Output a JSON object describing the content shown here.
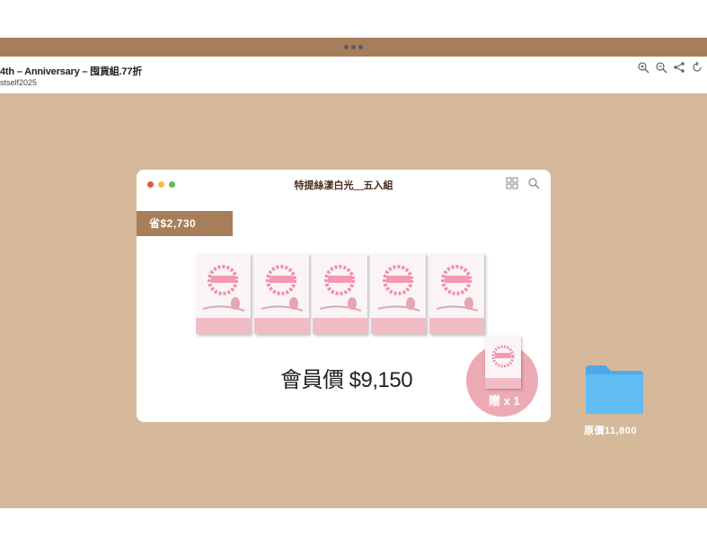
{
  "viewer": {
    "title": "4th – Anniversary – 囤貨組.77折",
    "subtitle": "stself2025",
    "icons": [
      "zoom-in-icon",
      "zoom-out-icon",
      "share-icon",
      "rotate-icon"
    ]
  },
  "window": {
    "title": "特提絲漾白光＿五入組",
    "traffic_colors": [
      "#e0553f",
      "#f2be3d",
      "#5dbd5a"
    ],
    "icons": [
      "grid-icon",
      "search-icon"
    ]
  },
  "promo": {
    "savings_tag": "省$2,730",
    "member_price": "會員價 $9,150",
    "gift_label": "贈 x 1",
    "book_count": 5
  },
  "folder": {
    "label": "原價11,800",
    "color": "#62bdf4"
  },
  "colors": {
    "brand": "#a77e5a",
    "canvas": "#d6b99a",
    "gift_circle": "#eeaab4"
  }
}
